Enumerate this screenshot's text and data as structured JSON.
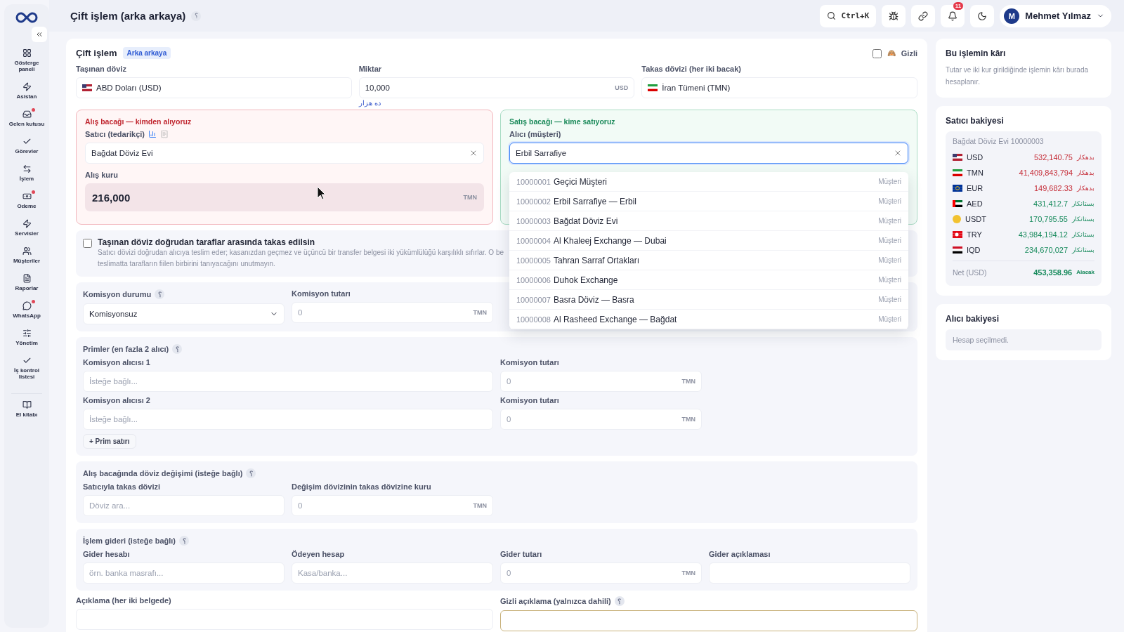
{
  "header": {
    "title": "Çift işlem (arka arkaya)",
    "help": "؟",
    "search_shortcut": "Ctrl+K",
    "notification_count": "11",
    "user": {
      "initial": "M",
      "name": "Mehmet Yılmaz"
    }
  },
  "sidebar": {
    "items": [
      {
        "label": "Gösterge paneli",
        "badge": false
      },
      {
        "label": "Asistan",
        "badge": false
      },
      {
        "label": "Gelen kutusu",
        "badge": true
      },
      {
        "label": "Görevler",
        "badge": false
      },
      {
        "label": "İşlem",
        "badge": false
      },
      {
        "label": "Odeme",
        "badge": true
      },
      {
        "label": "Servisler",
        "badge": false
      },
      {
        "label": "Müşteriler",
        "badge": false
      },
      {
        "label": "Raporlar",
        "badge": false
      },
      {
        "label": "WhatsApp",
        "badge": true
      },
      {
        "label": "Yönetim",
        "badge": false
      },
      {
        "label": "İş kontrol listesi",
        "badge": false
      }
    ],
    "footer_item": {
      "label": "El kitabı"
    }
  },
  "form": {
    "title": "Çift işlem",
    "tag": "Arka arkaya",
    "hidden": {
      "label": "Gizli",
      "icon": "🙈",
      "checked": false
    },
    "carried_currency": {
      "label": "Taşınan döviz",
      "value": "ABD Doları (USD)"
    },
    "amount": {
      "label": "Miktar",
      "value": "10,000",
      "unit": "USD",
      "hint": "ده هزار"
    },
    "swap_currency": {
      "label": "Takas dövizi (her iki bacak)",
      "value": "İran Tümeni (TMN)"
    },
    "buy_leg": {
      "title": "Alış bacağı — kimden alıyoruz",
      "seller_label": "Satıcı (tedarikçi)",
      "seller_value": "Bağdat Döviz Evi",
      "rate_label": "Alış kuru",
      "rate_value": "216,000",
      "rate_unit": "TMN"
    },
    "sell_leg": {
      "title": "Satış bacağı — kime satıyoruz",
      "buyer_label": "Alıcı (müşteri)",
      "buyer_value": "Erbil Sarrafiye",
      "options": [
        {
          "code": "10000001",
          "name": "Geçici Müşteri",
          "type": "Müşteri"
        },
        {
          "code": "10000002",
          "name": "Erbil Sarrafiye — Erbil",
          "type": "Müşteri"
        },
        {
          "code": "10000003",
          "name": "Bağdat Döviz Evi",
          "type": "Müşteri"
        },
        {
          "code": "10000004",
          "name": "Al Khaleej Exchange — Dubai",
          "type": "Müşteri"
        },
        {
          "code": "10000005",
          "name": "Tahran Sarraf Ortakları",
          "type": "Müşteri"
        },
        {
          "code": "10000006",
          "name": "Duhok Exchange",
          "type": "Müşteri"
        },
        {
          "code": "10000007",
          "name": "Basra Döviz — Basra",
          "type": "Müşteri"
        },
        {
          "code": "10000008",
          "name": "Al Rasheed Exchange — Bağdat",
          "type": "Müşteri"
        }
      ]
    },
    "direct_swap": {
      "checked": false,
      "label": "Taşınan döviz doğrudan taraflar arasında takas edilsin",
      "description_1": "Satıcı dövizi doğrudan alıcıya teslim eder; kasanızdan geçmez ve üçüncü bir transfer belgesi iki yükümlülüğü karşılıklı sıfırlar. O be",
      "description_2": "teslimatta tarafların fiilen birbirini tanıyacağını unutmayın."
    },
    "commission": {
      "status_label": "Komisyon durumu",
      "help": "؟",
      "status_value": "Komisyonsuz",
      "amount_label": "Komisyon tutarı",
      "amount_placeholder": "0",
      "unit": "TMN"
    },
    "primes": {
      "title": "Primler (en fazla 2 alıcı)",
      "help": "؟",
      "rows": [
        {
          "recipient_label": "Komisyon alıcısı 1",
          "placeholder": "İsteğe bağlı...",
          "amount_label": "Komisyon tutarı",
          "amount_placeholder": "0",
          "unit": "TMN"
        },
        {
          "recipient_label": "Komisyon alıcısı 2",
          "placeholder": "İsteğe bağlı...",
          "amount_label": "Komisyon tutarı",
          "amount_placeholder": "0",
          "unit": "TMN"
        }
      ],
      "add_button": "+ Prim satırı"
    },
    "exchange": {
      "title": "Alış bacağında döviz değişimi (isteğe bağlı)",
      "help": "؟",
      "currency_label": "Satıcıyla takas dövizi",
      "currency_placeholder": "Döviz ara...",
      "rate_label": "Değişim dövizinin takas dövizine kuru",
      "rate_placeholder": "0",
      "unit": "TMN"
    },
    "expense": {
      "title": "İşlem gideri (isteğe bağlı)",
      "help": "؟",
      "account_label": "Gider hesabı",
      "account_placeholder": "örn. banka masrafı...",
      "payer_label": "Ödeyen hesap",
      "payer_placeholder": "Kasa/banka...",
      "amount_label": "Gider tutarı",
      "amount_placeholder": "0",
      "unit": "TMN",
      "note_label": "Gider açıklaması"
    },
    "description_label": "Açıklama (her iki belgede)",
    "private_description_label": "Gizli açıklama (yalnızca dahili)",
    "private_help": "؟"
  },
  "profit": {
    "title": "Bu işlemin kârı",
    "text": "Tutar ve iki kur girildiğinde işlemin kârı burada hesaplanır."
  },
  "seller_balance": {
    "title": "Satıcı bakiyesi",
    "account": "Bağdat Döviz Evi 10000003",
    "rows": [
      {
        "code": "USD",
        "amount": "532,140.75",
        "note": "بدهکار",
        "kind": "debit"
      },
      {
        "code": "TMN",
        "amount": "41,409,843,794",
        "note": "بدهکار",
        "kind": "debit"
      },
      {
        "code": "EUR",
        "amount": "149,682.33",
        "note": "بدهکار",
        "kind": "debit"
      },
      {
        "code": "AED",
        "amount": "431,412.7",
        "note": "بستانکار",
        "kind": "credit"
      },
      {
        "code": "USDT",
        "amount": "170,795.55",
        "note": "بستانکار",
        "kind": "credit"
      },
      {
        "code": "TRY",
        "amount": "43,984,194.12",
        "note": "بستانکار",
        "kind": "credit"
      },
      {
        "code": "IQD",
        "amount": "234,670,027",
        "note": "بستانکار",
        "kind": "credit"
      }
    ],
    "net": {
      "label": "Net (USD)",
      "amount": "453,358.96",
      "note": "Alacak"
    }
  },
  "buyer_balance": {
    "title": "Alıcı bakiyesi",
    "empty": "Hesap seçilmedi."
  }
}
